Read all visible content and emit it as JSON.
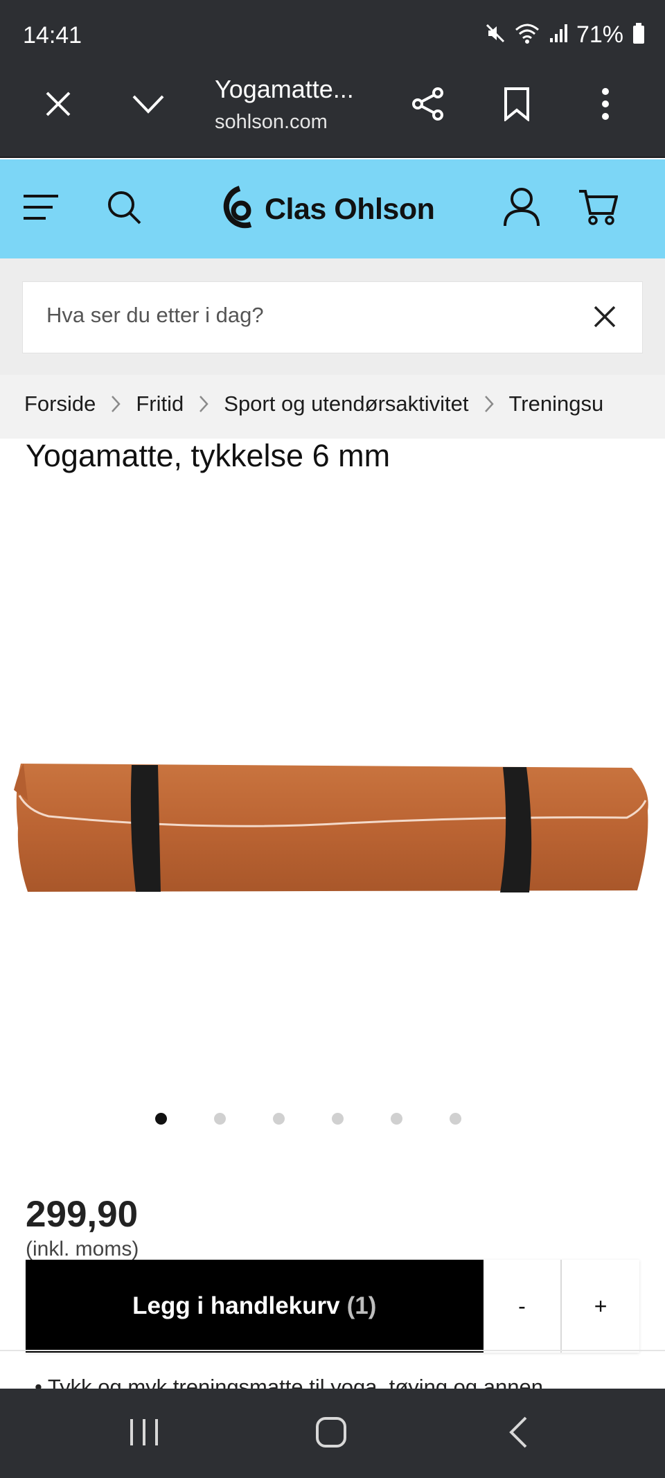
{
  "status_bar": {
    "time": "14:41",
    "battery_percent": "71%",
    "icons": [
      "mute-icon",
      "wifi-icon",
      "signal-icon",
      "battery-icon"
    ]
  },
  "browser": {
    "page_title": "Yogamatte...",
    "url": "sohlson.com",
    "icons": [
      "close-icon",
      "chevron-down-icon",
      "share-icon",
      "bookmark-icon",
      "more-vertical-icon"
    ]
  },
  "site_header": {
    "brand": "Clas Ohlson",
    "background_color": "#7cd6f6",
    "icons": [
      "menu-icon",
      "search-icon",
      "account-icon",
      "cart-icon"
    ]
  },
  "search": {
    "placeholder": "Hva ser du etter i dag?",
    "value": ""
  },
  "breadcrumb": {
    "items": [
      "Forside",
      "Fritid",
      "Sport og utendørsaktivitet",
      "Treningsu"
    ]
  },
  "product": {
    "title": "Yogamatte, tykkelse 6 mm",
    "image_alt": "rolled-brown-yoga-mat-with-black-straps",
    "carousel_total": 6,
    "carousel_active": 1,
    "price": "299,90",
    "vat_note": "(inkl. moms)",
    "add_to_cart_label": "Legg i handlekurv",
    "quantity_label": "(1)",
    "decrement_label": "-",
    "increment_label": "+",
    "description_first_line": "•  Tykk og myk treningsmatte til yoga, tøying og annen"
  },
  "nav_bar": {
    "icons": [
      "recent-apps-icon",
      "home-icon",
      "back-icon"
    ]
  }
}
